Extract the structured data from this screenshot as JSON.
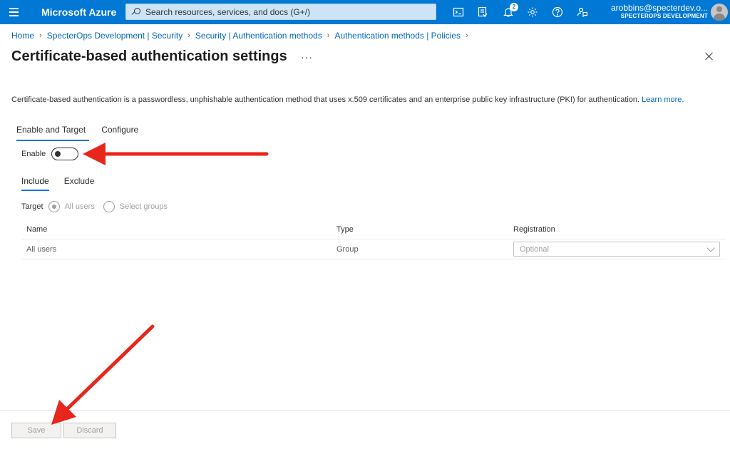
{
  "topbar": {
    "brand": "Microsoft Azure",
    "search_placeholder": "Search resources, services, and docs (G+/)",
    "notification_count": "2",
    "account_email": "arobbins@specterdev.o...",
    "account_tenant": "SPECTEROPS DEVELOPMENT"
  },
  "breadcrumb": [
    "Home",
    "SpecterOps Development | Security",
    "Security | Authentication methods",
    "Authentication methods | Policies"
  ],
  "page": {
    "title": "Certificate-based authentication settings",
    "more": "···",
    "description": "Certificate-based authentication is a passwordless, unphishable authentication method that uses x.509 certificates and an enterprise public key infrastructure (PKI) for authentication.",
    "learn_more": "Learn more."
  },
  "tabs": [
    {
      "label": "Enable and Target",
      "active": true
    },
    {
      "label": "Configure",
      "active": false
    }
  ],
  "enable": {
    "label": "Enable",
    "on": false
  },
  "subtabs": [
    {
      "label": "Include",
      "active": true
    },
    {
      "label": "Exclude",
      "active": false
    }
  ],
  "target": {
    "label": "Target",
    "options": [
      {
        "label": "All users",
        "checked": true
      },
      {
        "label": "Select groups",
        "checked": false
      }
    ]
  },
  "table": {
    "headers": [
      "Name",
      "Type",
      "Registration"
    ],
    "rows": [
      {
        "name": "All users",
        "type": "Group",
        "registration": "Optional"
      }
    ]
  },
  "footer": {
    "save_label": "Save",
    "discard_label": "Discard"
  },
  "colors": {
    "accent": "#0078d4",
    "link": "#0067b8",
    "annotation": "#e8261c"
  }
}
